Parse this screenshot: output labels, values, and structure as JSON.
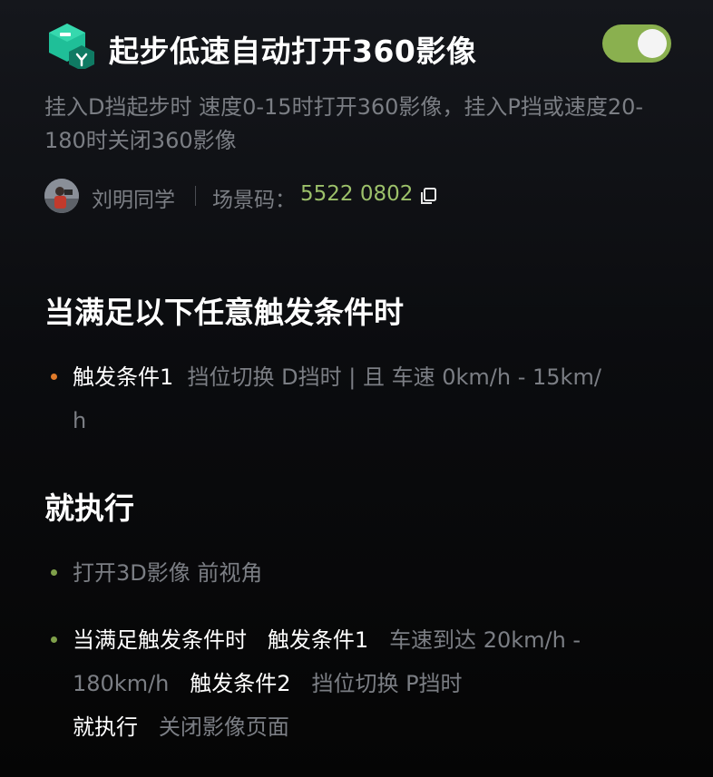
{
  "header": {
    "title": "起步低速自动打开360影像",
    "toggle_on": true,
    "accent_color": "#8ab04f"
  },
  "description": "挂入D挡起步时 速度0-15时打开360影像，挂入P挡或速度20-180时关闭360影像",
  "meta": {
    "author": "刘明同学",
    "scene_code_label": "场景码：",
    "scene_code": "5522 0802",
    "copy_icon": "copy-icon"
  },
  "trigger_section": {
    "title": "当满足以下任意触发条件时",
    "items": [
      {
        "name": "触发条件1",
        "detail_line1": "挡位切换 D挡时 | 且 车速 0km/h - 15km/",
        "detail_line2": "h"
      }
    ]
  },
  "action_section": {
    "title": "就执行",
    "item1": {
      "text": "打开3D影像 前视角"
    },
    "item2": {
      "when": "当满足触发条件时",
      "cond1_name": "触发条件1",
      "cond1_detail_a": "车速到达 20km/h -",
      "cond1_detail_b": "180km/h",
      "cond2_name": "触发条件2",
      "cond2_detail": "挡位切换 P挡时",
      "then": "就执行",
      "then_detail": "关闭影像页面"
    }
  },
  "colors": {
    "trigger_dot": "#e07b2a",
    "action_dot": "#7fa04a",
    "scene_code": "#9cc06a"
  }
}
